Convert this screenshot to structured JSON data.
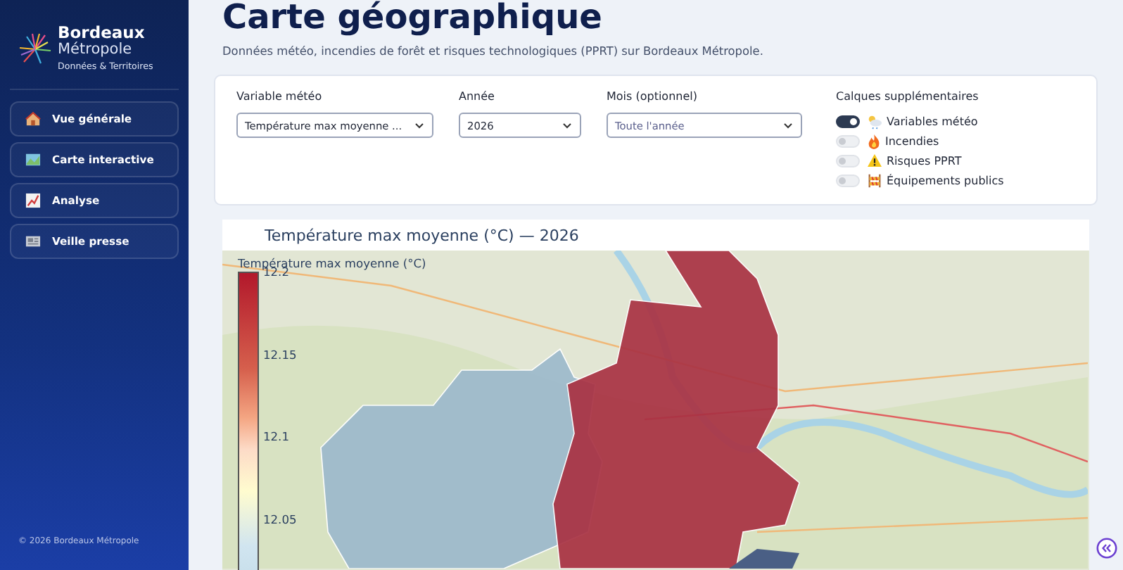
{
  "sidebar": {
    "logo": {
      "title": "Bordeaux",
      "subtitle": "Métropole",
      "tagline": "Données & Territoires"
    },
    "items": [
      {
        "label": "Vue générale",
        "selected": false
      },
      {
        "label": "Carte interactive",
        "selected": false
      },
      {
        "label": "Analyse",
        "selected": false
      },
      {
        "label": "Veille presse",
        "selected": false
      }
    ],
    "footer": "© 2026 Bordeaux Métropole"
  },
  "page": {
    "title": "Carte géographique",
    "subtitle": "Données météo, incendies de forêt et risques technologiques (PPRT) sur Bordeaux Métropole."
  },
  "filters": [
    {
      "label": "Variable météo",
      "value": "Température max moyenne ..."
    },
    {
      "label": "Année",
      "value": "2026"
    },
    {
      "label": "Mois (optionnel)",
      "placeholder": "Toute l'année"
    }
  ],
  "layers": {
    "title": "Calques supplémentaires",
    "items": [
      {
        "label": "Variables météo",
        "on": true
      },
      {
        "label": "Incendies",
        "on": false
      },
      {
        "label": "Risques PPRT",
        "on": false
      },
      {
        "label": "Équipements publics",
        "on": false
      }
    ]
  },
  "map": {
    "title": "Température max moyenne (°C) — 2026",
    "colorbar": {
      "title": "Température max moyenne (°C)",
      "ticks": [
        "12.2",
        "12.15",
        "12.1",
        "12.05"
      ]
    }
  }
}
